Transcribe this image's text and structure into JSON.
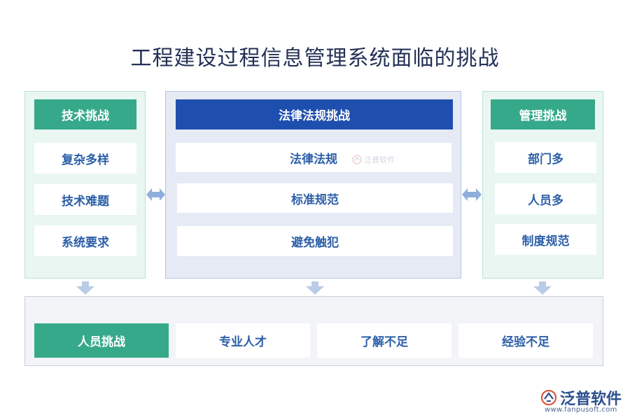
{
  "title": "工程建设过程信息管理系统面临的挑战",
  "left": {
    "header": "技术挑战",
    "items": [
      "复杂多样",
      "技术难题",
      "系统要求"
    ]
  },
  "center": {
    "header": "法律法规挑战",
    "items": [
      "法律法规",
      "标准规范",
      "避免触犯"
    ]
  },
  "right": {
    "header": "管理挑战",
    "items": [
      "部门多",
      "人员多",
      "制度规范"
    ]
  },
  "bottom": {
    "header": "人员挑战",
    "items": [
      "专业人才",
      "了解不足",
      "经验不足"
    ]
  },
  "watermark": "泛普软件",
  "logo": {
    "brand": "泛普软件",
    "url": "www.fanpusoft.com"
  },
  "colors": {
    "green": "#36a98a",
    "blue": "#1f4fae",
    "text_blue": "#2c5fa8",
    "arrow": "#8faedb"
  }
}
